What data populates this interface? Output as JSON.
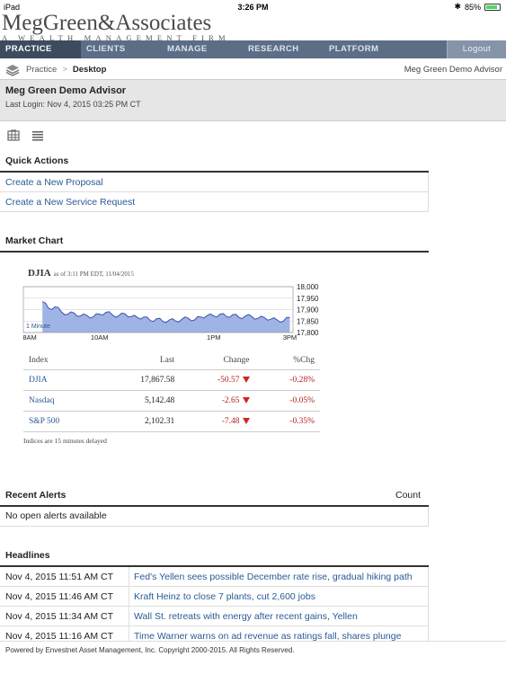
{
  "status_bar": {
    "device": "iPad",
    "time": "3:26 PM",
    "battery": "85%"
  },
  "logo": {
    "name": "MegGreen&Associates",
    "tagline": "A WEALTH MANAGEMENT FIRM"
  },
  "nav": {
    "items": [
      "PRACTICE",
      "CLIENTS",
      "MANAGE",
      "RESEARCH",
      "PLATFORM"
    ],
    "logout": "Logout"
  },
  "breadcrumb": {
    "parent": "Practice",
    "current": "Desktop",
    "advisor": "Meg Green Demo Advisor"
  },
  "advisor_header": {
    "name": "Meg Green Demo Advisor",
    "last_login": "Last Login: Nov 4, 2015 03:25 PM CT"
  },
  "quick_actions": {
    "title": "Quick Actions",
    "items": [
      "Create a New Proposal",
      "Create a New Service Request"
    ]
  },
  "market_chart": {
    "title": "Market Chart",
    "symbol": "DJIA",
    "as_of": "as of 3:11 PM EDT, 11/04/2015",
    "interval_label": "1 Minute",
    "delay_note": "Indices are 15 minutes delayed",
    "table": {
      "headers": [
        "Index",
        "Last",
        "Change",
        "%Chg"
      ],
      "rows": [
        [
          "DJIA",
          "17,867.58",
          "-50.57",
          "-0.28%"
        ],
        [
          "Nasdaq",
          "5,142.48",
          "-2.65",
          "-0.05%"
        ],
        [
          "S&P 500",
          "2,102.31",
          "-7.48",
          "-0.35%"
        ]
      ]
    }
  },
  "chart_data": {
    "type": "area",
    "title": "DJIA",
    "xlabel": "",
    "ylabel": "",
    "x_ticks": [
      "8AM",
      "10AM",
      "1PM",
      "3PM"
    ],
    "y_ticks": [
      "18,000",
      "17,950",
      "17,900",
      "17,850",
      "17,800"
    ],
    "ylim": [
      17800,
      18000
    ],
    "grid": true,
    "series": [
      {
        "x": [
          "8:30",
          "8:40",
          "8:50",
          "9:00",
          "9:10",
          "9:20",
          "9:30",
          "9:40",
          "9:50",
          "10:00",
          "10:10",
          "10:20",
          "10:30",
          "10:40",
          "10:50",
          "11:00",
          "11:10",
          "11:20",
          "11:30",
          "11:40",
          "11:50",
          "12:00",
          "12:10",
          "12:20",
          "12:30",
          "12:40",
          "12:50",
          "13:00",
          "13:10",
          "13:20",
          "13:30",
          "13:40",
          "13:50",
          "14:00",
          "14:10",
          "14:20",
          "14:30",
          "14:40",
          "14:50",
          "15:00"
        ],
        "values": [
          17935,
          17905,
          17912,
          17890,
          17880,
          17885,
          17872,
          17875,
          17868,
          17880,
          17888,
          17878,
          17872,
          17882,
          17870,
          17865,
          17868,
          17852,
          17860,
          17848,
          17855,
          17850,
          17858,
          17862,
          17855,
          17868,
          17875,
          17872,
          17880,
          17870,
          17878,
          17865,
          17872,
          17870,
          17862,
          17865,
          17858,
          17855,
          17850,
          17865
        ]
      }
    ]
  },
  "recent_alerts": {
    "title": "Recent Alerts",
    "count_label": "Count",
    "empty_text": "No open alerts available"
  },
  "headlines": {
    "title": "Headlines",
    "items": [
      {
        "time": "Nov 4, 2015 11:51 AM CT",
        "title": "Fed's Yellen sees possible December rate rise, gradual hiking path"
      },
      {
        "time": "Nov 4, 2015 11:46 AM CT",
        "title": "Kraft Heinz to close 7 plants, cut 2,600 jobs"
      },
      {
        "time": "Nov 4, 2015 11:34 AM CT",
        "title": "Wall St. retreats with energy after recent gains, Yellen"
      },
      {
        "time": "Nov 4, 2015 11:16 AM CT",
        "title": "Time Warner warns on ad revenue as ratings fall, shares plunge"
      }
    ]
  },
  "footer": {
    "text": "Powered by Envestnet Asset Management, Inc. Copyright 2000-2015. All Rights Reserved."
  },
  "colors": {
    "nav": "#5c6e86",
    "nav_active": "#3d4b5f",
    "link": "#2a5a96",
    "negative": "#b02020",
    "chart_fill": "#9fb3e4",
    "chart_line": "#3a52a8"
  }
}
